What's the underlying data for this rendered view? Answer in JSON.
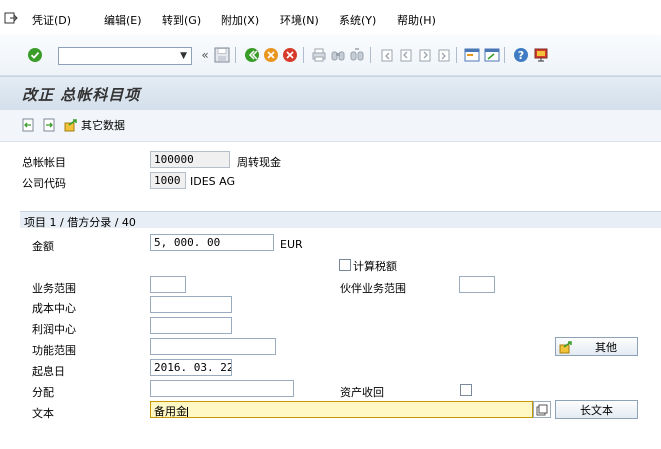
{
  "menu": {
    "items": [
      "凭证(D)",
      "编辑(E)",
      "转到(G)",
      "附加(X)",
      "环境(N)",
      "系统(Y)",
      "帮助(H)"
    ]
  },
  "toolbar": {
    "command_value": "",
    "icons": [
      "enter-icon",
      "back-icon",
      "save-icon",
      "nav-back-icon",
      "exit-icon",
      "cancel-icon",
      "print-icon",
      "find-icon",
      "find-next-icon",
      "first-page-icon",
      "prev-page-icon",
      "next-page-icon",
      "last-page-icon",
      "new-session-icon",
      "shortcut-icon",
      "help-icon",
      "layout-icon"
    ]
  },
  "title": "改正 总帐科目项",
  "app_toolbar": {
    "other_data_label": "其它数据"
  },
  "header": {
    "gl_account_label": "总帐帐目",
    "gl_account_value": "100000",
    "gl_account_desc": "周转现金",
    "company_code_label": "公司代码",
    "company_code_value": "1000",
    "company_code_desc": "IDES AG"
  },
  "item": {
    "section_title": "项目 1 / 借方分录 / 40",
    "amount_label": "金额",
    "amount_value": "5, 000. 00",
    "currency": "EUR",
    "calc_tax_label": "计算税额",
    "business_area_label": "业务范围",
    "business_area_value": "",
    "partner_ba_label": "伙伴业务范围",
    "partner_ba_value": "",
    "cost_center_label": "成本中心",
    "cost_center_value": "",
    "profit_center_label": "利润中心",
    "profit_center_value": "",
    "functional_area_label": "功能范围",
    "functional_area_value": "",
    "other_button_label": "其他",
    "value_date_label": "起息日",
    "value_date_value": "2016. 03. 22",
    "assignment_label": "分配",
    "assignment_value": "",
    "asset_retirement_label": "资产收回",
    "text_label": "文本",
    "text_value": "备用金",
    "long_text_button_label": "长文本"
  },
  "colors": {
    "accent_green": "#3a9d2a",
    "exit_orange": "#e8961e",
    "cancel_red": "#d53a2a",
    "title_bg": "#d3dfeb",
    "highlight_field": "#fff7c4"
  }
}
